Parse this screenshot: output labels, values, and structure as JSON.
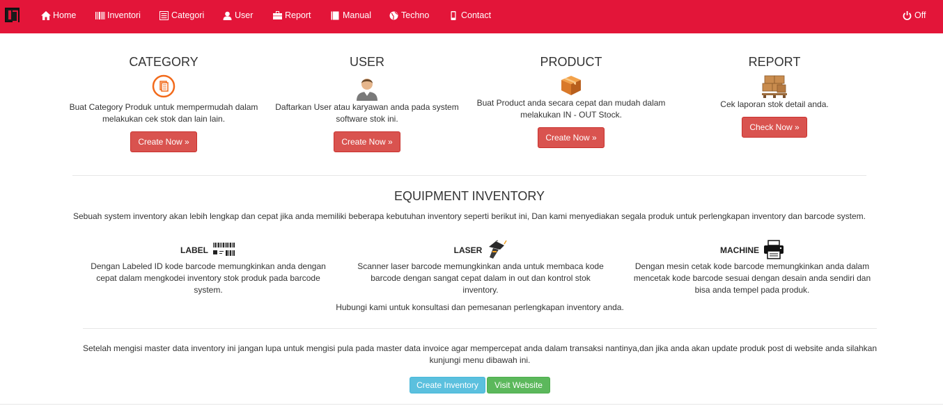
{
  "nav": {
    "items": [
      {
        "label": "Home",
        "icon": "home-icon"
      },
      {
        "label": "Inventori",
        "icon": "barcode-icon"
      },
      {
        "label": "Categori",
        "icon": "list-icon"
      },
      {
        "label": "User",
        "icon": "user-icon"
      },
      {
        "label": "Report",
        "icon": "briefcase-icon"
      },
      {
        "label": "Manual",
        "icon": "book-icon"
      },
      {
        "label": "Techno",
        "icon": "globe-icon"
      },
      {
        "label": "Contact",
        "icon": "phone-icon"
      }
    ],
    "logout": {
      "label": "Off",
      "icon": "power-icon"
    },
    "bg_color": "#e31539"
  },
  "features": [
    {
      "title": "CATEGORY",
      "icon": "category-icon",
      "text": "Buat Category Produk untuk mempermudah dalam melakukan cek stok dan lain lain.",
      "button": "Create Now »"
    },
    {
      "title": "USER",
      "icon": "user-avatar-icon",
      "text": "Daftarkan User atau karyawan anda pada system software stok ini.",
      "button": "Create Now »"
    },
    {
      "title": "PRODUCT",
      "icon": "product-box-icon",
      "text": "Buat Product anda secara cepat dan mudah dalam melakukan IN - OUT Stock.",
      "button": "Create Now »"
    },
    {
      "title": "REPORT",
      "icon": "pallet-boxes-icon",
      "text": "Cek laporan stok detail anda.",
      "button": "Check Now »"
    }
  ],
  "equipment": {
    "title": "EQUIPMENT INVENTORY",
    "description": "Sebuah system inventory akan lebih lengkap dan cepat jika anda memiliki beberapa kebutuhan inventory seperti berikut ini, Dan kami menyediakan segala produk untuk perlengkapan inventory dan barcode system.",
    "items": [
      {
        "title": "LABEL",
        "icon": "barcode-label-icon",
        "text": "Dengan Labeled ID kode barcode memungkinkan anda dengan cepat dalam mengkodei inventory stok produk pada barcode system."
      },
      {
        "title": "LASER",
        "icon": "laser-scanner-icon",
        "text": "Scanner laser barcode memungkinkan anda untuk membaca kode barcode dengan sangat cepat dalam in out dan kontrol stok inventory."
      },
      {
        "title": "MACHINE",
        "icon": "printer-icon",
        "text": "Dengan mesin cetak kode barcode memungkinkan anda dalam mencetak kode barcode sesuai dengan desain anda sendiri dan bisa anda tempel pada produk."
      }
    ],
    "contact_line": "Hubungi kami untuk konsultasi dan pemesanan perlengkapan inventory anda."
  },
  "footer": {
    "note": "Setelah mengisi master data inventory ini jangan lupa untuk mengisi pula pada master data invoice agar mempercepat anda dalam transaksi nantinya,dan jika anda akan update produk post di website anda silahkan kunjungi menu dibawah ini.",
    "create_inventory": "Create Inventory",
    "visit_website": "Visit Website"
  }
}
